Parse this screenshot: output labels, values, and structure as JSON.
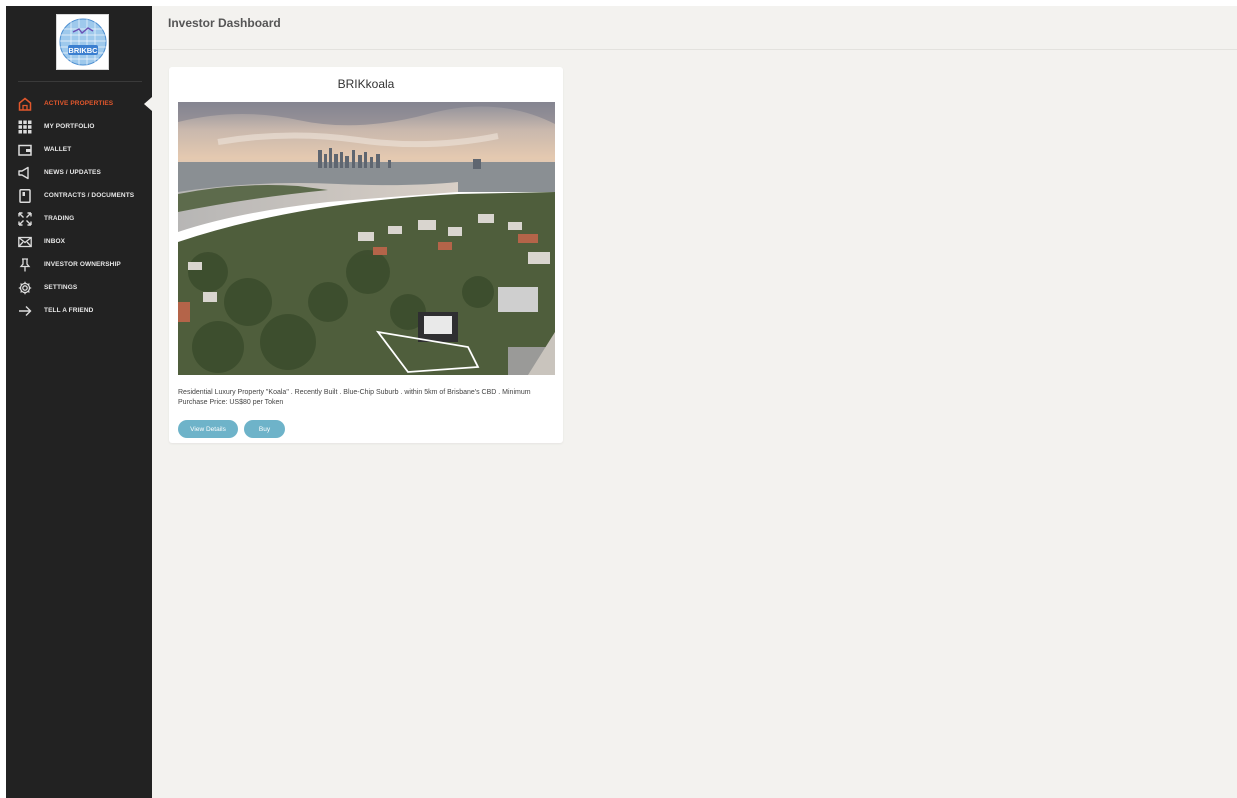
{
  "header": {
    "title": "Investor Dashboard"
  },
  "logo": {
    "text": "BRIKBC"
  },
  "sidebar": {
    "items": [
      {
        "label": "ACTIVE PROPERTIES",
        "icon": "home-icon",
        "active": true
      },
      {
        "label": "MY PORTFOLIO",
        "icon": "grid-icon"
      },
      {
        "label": "WALLET",
        "icon": "wallet-icon"
      },
      {
        "label": "NEWS / UPDATES",
        "icon": "megaphone-icon"
      },
      {
        "label": "CONTRACTS / DOCUMENTS",
        "icon": "document-icon"
      },
      {
        "label": "TRADING",
        "icon": "expand-arrows-icon"
      },
      {
        "label": "INBOX",
        "icon": "envelope-icon"
      },
      {
        "label": "INVESTOR OWNERSHIP",
        "icon": "pin-icon"
      },
      {
        "label": "SETTINGS",
        "icon": "gear-icon"
      },
      {
        "label": "TELL A FRIEND",
        "icon": "arrow-right-icon"
      }
    ]
  },
  "property_card": {
    "title": "BRIKkoala",
    "description": "Residential Luxury Property \"Koala\" . Recently Built . Blue-Chip Suburb . within 5km of Brisbane's CBD . Minimum Purchase Price: US$80 per Token",
    "view_details_label": "View Details",
    "buy_label": "Buy"
  },
  "colors": {
    "sidebar_bg": "#222222",
    "active": "#e2572c",
    "page_bg": "#f3f2ef",
    "button": "#6eb3c9"
  }
}
